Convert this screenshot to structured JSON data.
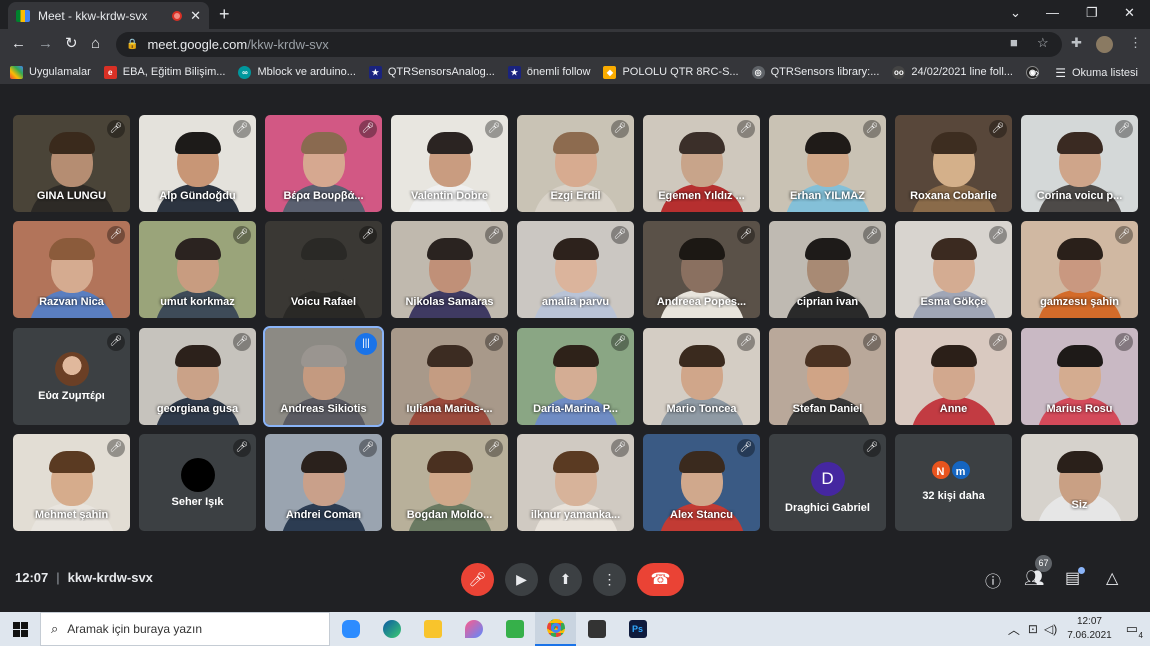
{
  "browser": {
    "tab_title": "Meet - kkw-krdw-svx",
    "url_domain": "meet.google.com",
    "url_path": "/kkw-krdw-svx"
  },
  "bookmarks": [
    {
      "label": "Uygulamalar",
      "color": "#ea4335"
    },
    {
      "label": "EBA, Eğitim Bilişim...",
      "color": "#d93025"
    },
    {
      "label": "Mblock ve arduino...",
      "color": "#00979d"
    },
    {
      "label": "QTRSensorsAnalog...",
      "color": "#1a237e"
    },
    {
      "label": "önemli follow",
      "color": "#1a237e"
    },
    {
      "label": "POLOLU QTR 8RC-S...",
      "color": "#f9ab00"
    },
    {
      "label": "QTRSensors library:...",
      "color": "#5f6368"
    },
    {
      "label": "24/02/2021 line foll...",
      "color": "#444"
    },
    {
      "label": "",
      "color": "#222"
    }
  ],
  "bookmarks_more": "»",
  "reading_list": "Okuma listesi",
  "participants": [
    {
      "name": "GINA LUNGU",
      "bg": "#4a4438",
      "skin": "#b58d72",
      "shirt": "#2d2a26",
      "hair": "#3a2a1c"
    },
    {
      "name": "Alp Gündoğdu",
      "bg": "#e4e2dc",
      "skin": "#c89676",
      "shirt": "#2c3440",
      "hair": "#1d1b19"
    },
    {
      "name": "Βέρα Βουρβά...",
      "bg": "#d25884",
      "skin": "#d6a890",
      "shirt": "#5a6070",
      "hair": "#8a6a50"
    },
    {
      "name": "Valentin Dobre",
      "bg": "#e8e6e0",
      "skin": "#c99c80",
      "shirt": "#efefef",
      "hair": "#2b2422"
    },
    {
      "name": "Ezgi Erdil",
      "bg": "#c9c3b5",
      "skin": "#d7ab90",
      "shirt": "#d8d2c8",
      "hair": "#8d6b4f"
    },
    {
      "name": "Egemen Yıldız ...",
      "bg": "#cfc8bd",
      "skin": "#c8a48a",
      "shirt": "#b62f2f",
      "hair": "#3b2f29"
    },
    {
      "name": "Erhan YILMAZ",
      "bg": "#c9c2b4",
      "skin": "#d0a788",
      "shirt": "#84c0d8",
      "hair": "#1f1b18"
    },
    {
      "name": "Roxana Cobarlie",
      "bg": "#58473a",
      "skin": "#d4b08a",
      "shirt": "#8a6b4a",
      "hair": "#3d2d20"
    },
    {
      "name": "Corina voicu p...",
      "bg": "#d4d8d8",
      "skin": "#cfa58a",
      "shirt": "#4d4a48",
      "hair": "#3a2a22"
    },
    {
      "name": "Razvan Nica",
      "bg": "#b2745a",
      "skin": "#d5ab90",
      "shirt": "#5a7ec0",
      "hair": "#8b5b3b"
    },
    {
      "name": "umut korkmaz",
      "bg": "#9aa47a",
      "skin": "#c89c80",
      "shirt": "#3e4b58",
      "hair": "#2b2320"
    },
    {
      "name": "Voicu Rafael",
      "bg": "#3a3834",
      "skin": "#3a3834",
      "shirt": "#2a2926",
      "hair": "#2a2926"
    },
    {
      "name": "Nikolas Samaras",
      "bg": "#c0b9ae",
      "skin": "#c09078",
      "shirt": "#3f3a62",
      "hair": "#2a2320"
    },
    {
      "name": "amalia parvu",
      "bg": "#cbc7c2",
      "skin": "#dbb49c",
      "shirt": "#b9c3d6",
      "hair": "#2d221c"
    },
    {
      "name": "Andreea Popes...",
      "bg": "#5a5148",
      "skin": "#8a7060",
      "shirt": "#e8e4dc",
      "hair": "#1c1814"
    },
    {
      "name": "ciprian ivan",
      "bg": "#bfbab2",
      "skin": "#a88a74",
      "shirt": "#2a2a2a",
      "hair": "#1e1b19"
    },
    {
      "name": "Esma Gökçe",
      "bg": "#d8d4cf",
      "skin": "#d4ac92",
      "shirt": "#a0a6b6",
      "hair": "#3b2a20"
    },
    {
      "name": "gamzesu şahin",
      "bg": "#d0b8a2",
      "skin": "#c99880",
      "shirt": "#d46b2a",
      "hair": "#2a201a"
    },
    {
      "name": "Andreas Sikiotis",
      "bg": "#8c8a84",
      "skin": "#c49a80",
      "shirt": "#5a5a62",
      "hair": "#9a9590"
    },
    {
      "name": "georgiana gusa",
      "bg": "#c6c3bd",
      "skin": "#caa288",
      "shirt": "#2f3a4a",
      "hair": "#2c211b"
    },
    {
      "name": "Iuliana Marius-...",
      "bg": "#a8998a",
      "skin": "#c49c82",
      "shirt": "#9b4a3c",
      "hair": "#3c2c22"
    },
    {
      "name": "Daria-Marina P...",
      "bg": "#8aa684",
      "skin": "#d4ad94",
      "shirt": "#6f8cc4",
      "hair": "#2e2219"
    },
    {
      "name": "Mario Toncea",
      "bg": "#d4cdc4",
      "skin": "#d0a68a",
      "shirt": "#8f9aa4",
      "hair": "#3a2a1e"
    },
    {
      "name": "Stefan Daniel",
      "bg": "#b9a89a",
      "skin": "#d0a486",
      "shirt": "#3a3a3a",
      "hair": "#4a3222"
    },
    {
      "name": "Anne",
      "bg": "#d9c9c0",
      "skin": "#d2a88e",
      "shirt": "#c23b42",
      "hair": "#2b1f18"
    },
    {
      "name": "Marius Rosu",
      "bg": "#c9b9c4",
      "skin": "#d4ac90",
      "shirt": "#d44a5a",
      "hair": "#1e1a18"
    },
    {
      "name": "Mehmet şahin",
      "bg": "#e2ddd4",
      "skin": "#d6ac8c",
      "shirt": "#e8e4de",
      "hair": "#5a3a22"
    },
    {
      "name": "Andrei Coman",
      "bg": "#9aa4b0",
      "skin": "#c9a08a",
      "shirt": "#2c3c52",
      "hair": "#2a211c"
    },
    {
      "name": "Bogdan Moldo...",
      "bg": "#b8b09a",
      "skin": "#d0a88a",
      "shirt": "#6a7a62",
      "hair": "#4a3020"
    },
    {
      "name": "ilknur yamanka...",
      "bg": "#d0cac2",
      "skin": "#d7b39a",
      "shirt": "#e8e2da",
      "hair": "#5a3a22"
    },
    {
      "name": "Alex Stancu",
      "bg": "#3a5a84",
      "skin": "#d0a88c",
      "shirt": "#c23b34",
      "hair": "#3a2a1e"
    },
    {
      "name": "Siz",
      "bg": "#d6d2cc",
      "skin": "#c9a084",
      "shirt": "#e6e6e6",
      "hair": "#2a201a"
    }
  ],
  "placeholder_tiles": {
    "eua": {
      "name": "Εύα Ζυμπέρι"
    },
    "seher": {
      "name": "Seher Işık"
    },
    "draghici": {
      "name": "Draghici Gabriel",
      "initial": "D",
      "color": "#4527a0"
    },
    "more": {
      "label": "32 kişi daha",
      "chip1": "N",
      "chip2": "m",
      "chip1_color": "#e8541e",
      "chip2_color": "#1565c0"
    }
  },
  "meeting": {
    "time": "12:07",
    "code": "kkw-krdw-svx",
    "participant_count": "67"
  },
  "taskbar": {
    "search_placeholder": "Aramak için buraya yazın",
    "time": "12:07",
    "date": "7.06.2021",
    "notif": "4"
  }
}
